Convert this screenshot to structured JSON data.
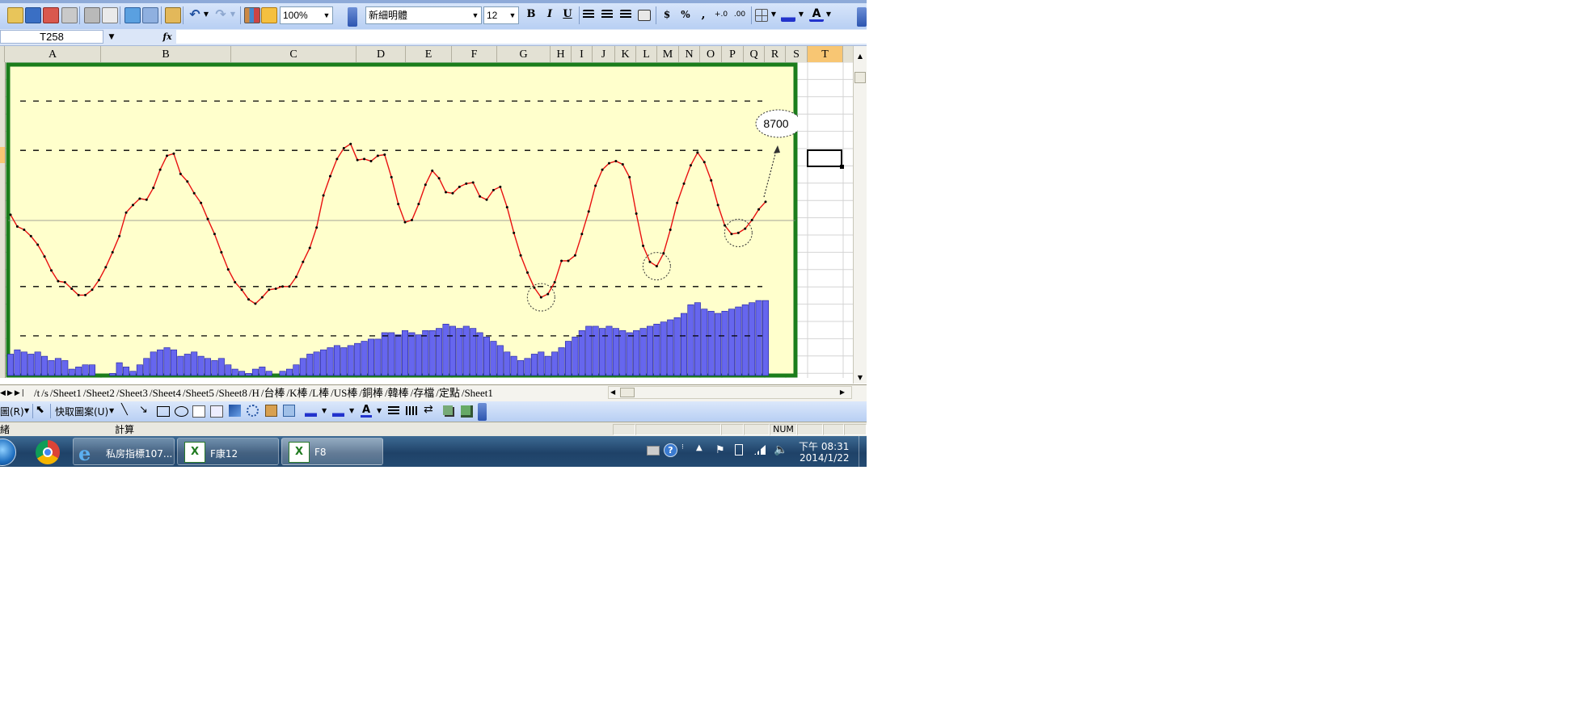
{
  "toolbar": {
    "zoom": "100%",
    "font_name": "新細明體",
    "font_size": "12",
    "bold_label": "B",
    "italic_label": "I",
    "underline_label": "U",
    "currency_label": "$",
    "percent_label": "%",
    "comma_label": ",",
    "accent_color": "#316ac5"
  },
  "formula_bar": {
    "name_box": "T258",
    "fx_label": "fx",
    "content": ""
  },
  "columns": [
    "A",
    "B",
    "C",
    "D",
    "E",
    "F",
    "G",
    "H",
    "I",
    "J",
    "K",
    "L",
    "M",
    "N",
    "O",
    "P",
    "Q",
    "R",
    "S",
    "T"
  ],
  "selected_column": "T",
  "chart_data": {
    "type": "line",
    "series": [
      {
        "values": [
          9.0,
          8.45,
          8.3,
          8.0,
          7.6,
          7.05,
          6.4,
          5.9,
          5.85,
          5.55,
          5.25,
          5.25,
          5.5,
          5.95,
          6.55,
          7.25,
          8.0,
          9.1,
          9.45,
          9.75,
          9.7,
          10.25,
          11.1,
          11.75,
          11.85,
          10.9,
          10.55,
          10.0,
          9.55,
          8.8,
          8.1,
          7.25,
          6.45,
          5.85,
          5.5,
          5.05,
          4.85,
          5.15,
          5.5,
          5.55,
          5.65,
          5.65,
          6.1,
          6.8,
          7.45,
          8.4,
          9.9,
          10.8,
          11.6,
          12.1,
          12.3,
          11.55,
          11.6,
          11.5,
          11.75,
          11.8,
          10.75,
          9.5,
          8.65,
          8.75,
          9.5,
          10.4,
          11.05,
          10.7,
          10.05,
          10.0,
          10.3,
          10.45,
          10.5,
          9.85,
          9.7,
          10.15,
          10.3,
          9.35,
          8.15,
          7.1,
          6.3,
          5.6,
          5.15,
          5.3,
          5.85,
          6.85,
          6.85,
          7.1,
          8.1,
          9.15,
          10.35,
          11.1,
          11.4,
          11.5,
          11.35,
          10.75,
          9.05,
          7.55,
          6.8,
          6.6,
          7.2,
          8.3,
          9.55,
          10.45,
          11.3,
          11.9,
          11.45,
          10.6,
          9.45,
          8.5,
          8.1,
          8.15,
          8.35,
          8.75,
          9.25,
          9.6
        ]
      },
      {
        "values": [
          2.5,
          2.7,
          2.6,
          2.5,
          2.6,
          2.4,
          2.2,
          2.3,
          2.2,
          1.8,
          1.9,
          2.0,
          2.0,
          1.5,
          1.2,
          1.6,
          2.1,
          1.9,
          1.7,
          2.0,
          2.3,
          2.6,
          2.7,
          2.8,
          2.7,
          2.4,
          2.5,
          2.6,
          2.4,
          2.3,
          2.2,
          2.3,
          2.0,
          1.8,
          1.7,
          1.6,
          1.8,
          1.9,
          1.7,
          1.5,
          1.7,
          1.8,
          2.0,
          2.3,
          2.5,
          2.6,
          2.7,
          2.8,
          2.9,
          2.8,
          2.9,
          3.0,
          3.1,
          3.2,
          3.2,
          3.5,
          3.5,
          3.4,
          3.6,
          3.5,
          3.4,
          3.6,
          3.6,
          3.7,
          3.9,
          3.8,
          3.7,
          3.8,
          3.7,
          3.5,
          3.3,
          3.1,
          2.9,
          2.6,
          2.4,
          2.2,
          2.3,
          2.5,
          2.6,
          2.4,
          2.6,
          2.8,
          3.1,
          3.3,
          3.6,
          3.8,
          3.8,
          3.7,
          3.8,
          3.7,
          3.6,
          3.5,
          3.6,
          3.7,
          3.8,
          3.9,
          4.0,
          4.1,
          4.2,
          4.4,
          4.8,
          4.9,
          4.6,
          4.5,
          4.4,
          4.5,
          4.6,
          4.7,
          4.8,
          4.9,
          5.0,
          5.0
        ]
      }
    ],
    "reference_lines": [
      14.3,
      12.0,
      5.65,
      3.35
    ],
    "ylim": [
      1.5,
      16.0
    ],
    "chart_type_note": "line",
    "annotation_label": "8700",
    "colors": {
      "plot_background": "#ffffcc",
      "border": "#1b7d1b",
      "line": "#e81010",
      "bars": "#6666ee"
    }
  },
  "sheet_tabs": [
    "t",
    "s",
    "Sheet1",
    "Sheet2",
    "Sheet3",
    "Sheet4",
    "Sheet5",
    "Sheet8",
    "H",
    "台棒",
    "K棒",
    "L棒",
    "US棒",
    "銅棒",
    "韓棒",
    "存檔",
    "定點",
    "Sheet1"
  ],
  "draw_toolbar": {
    "draw_menu": "圖(R)",
    "autoshapes_menu": "快取圖案(U)"
  },
  "status_bar": {
    "left_text": "緒",
    "mode_text": "計算",
    "num_indicator": "NUM"
  },
  "taskbar": {
    "buttons": [
      "私房指標107...",
      "F康12",
      "F8"
    ],
    "time": "下午 08:31",
    "date": "2014/1/22"
  }
}
